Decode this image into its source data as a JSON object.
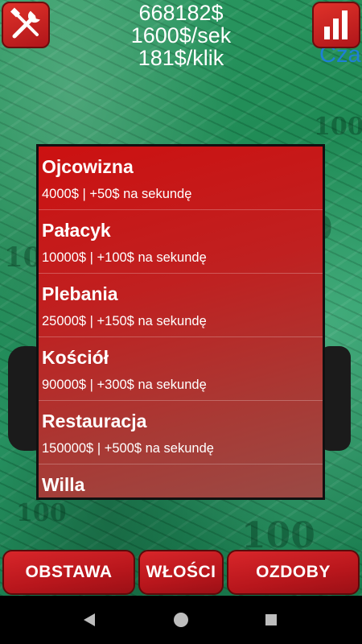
{
  "header": {
    "money": "668182$",
    "per_second": "1600$/sek",
    "per_click": "181$/klik",
    "overlay_text": "Cza"
  },
  "icons": {
    "tools": "tools-icon",
    "stats": "bar-chart-icon"
  },
  "colors": {
    "button_red": "#c8161c",
    "background_green": "#1f8a55",
    "overlay_blue": "#1e7fd6"
  },
  "properties": [
    {
      "name": "Ojcowizna",
      "desc": "4000$ | +50$ na sekundę"
    },
    {
      "name": "Pałacyk",
      "desc": "10000$ | +100$ na sekundę"
    },
    {
      "name": "Plebania",
      "desc": "25000$ | +150$ na sekundę"
    },
    {
      "name": "Kościół",
      "desc": "90000$ | +300$ na sekundę"
    },
    {
      "name": "Restauracja",
      "desc": "150000$ | +500$ na sekundę"
    },
    {
      "name": "Willa",
      "desc": ""
    }
  ],
  "bottom_nav": {
    "obstawa": "OBSTAWA",
    "wlosci": "WŁOŚCI",
    "ozdoby": "OZDOBY"
  }
}
